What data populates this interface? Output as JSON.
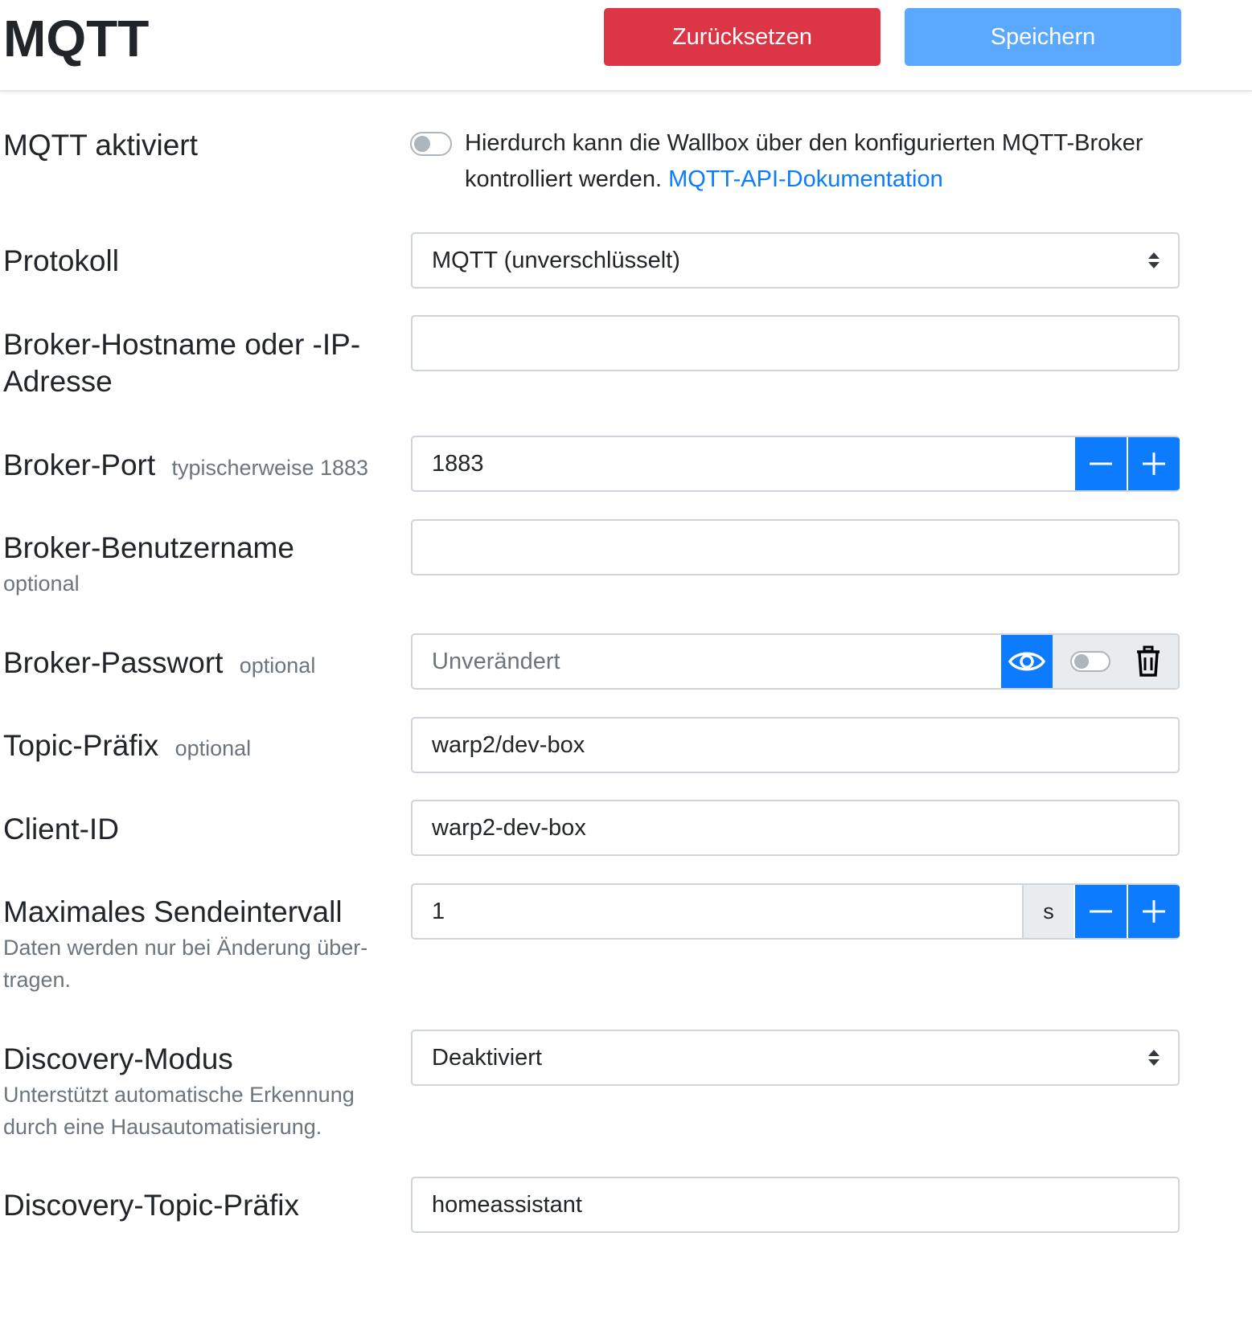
{
  "header": {
    "title": "MQTT",
    "reset_label": "Zurücksetzen",
    "save_label": "Speichern"
  },
  "colors": {
    "danger": "#dc3545",
    "primary": "#0d7bfd",
    "primary_disabled": "#5aa8ff"
  },
  "form": {
    "enable": {
      "label": "MQTT aktiviert",
      "enabled": false,
      "description": "Hierdurch kann die Wallbox über den konfigurierten MQTT-Broker kontrolliert werden.",
      "link_text": "MQTT-API-Dokumentation"
    },
    "protocol": {
      "label": "Protokoll",
      "selected": "MQTT (unverschlüsselt)"
    },
    "host": {
      "label": "Broker-Hostname oder -IP-Adresse",
      "value": ""
    },
    "port": {
      "label": "Broker-Port",
      "hint": "typischerweise 1883",
      "value": "1883",
      "minus_icon": "minus-icon",
      "plus_icon": "plus-icon"
    },
    "username": {
      "label": "Broker-Benutzername",
      "hint": "optional",
      "value": ""
    },
    "password": {
      "label": "Broker-Passwort",
      "hint": "optional",
      "placeholder": "Unverändert",
      "show_icon": "eye-icon",
      "clear_icon": "trash-icon"
    },
    "topic_prefix": {
      "label": "Topic-Präfix",
      "hint": "optional",
      "value": "warp2/dev-box"
    },
    "client_id": {
      "label": "Client-ID",
      "value": "warp2-dev-box"
    },
    "send_interval": {
      "label": "Maximales Sendeintervall",
      "hint_line1": "Daten werden nur bei Änderung über-",
      "hint_line2": "tragen.",
      "value": "1",
      "unit": "s"
    },
    "discovery_mode": {
      "label": "Discovery-Modus",
      "hint_line1": "Unterstützt automatische Erkennung",
      "hint_line2": "durch eine Hausautomatisierung.",
      "selected": "Deaktiviert"
    },
    "discovery_prefix": {
      "label": "Discovery-Topic-Präfix",
      "value": "homeassistant"
    }
  }
}
